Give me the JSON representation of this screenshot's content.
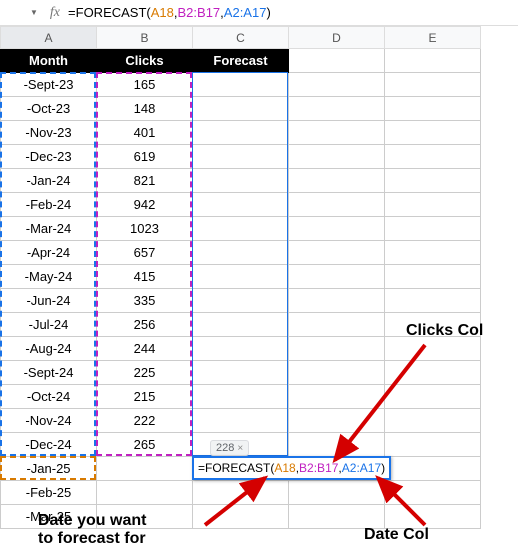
{
  "formula_bar": {
    "fx_label": "fx",
    "formula_prefix": "=FORECAST(",
    "ref1": "A18",
    "comma": ",",
    "ref2": "B2:B17",
    "ref3": "A2:A17",
    "formula_suffix": ")"
  },
  "columns": {
    "A": "A",
    "B": "B",
    "C": "C",
    "D": "D",
    "E": "E"
  },
  "headers": {
    "A": "Month",
    "B": "Clicks",
    "C": "Forecast"
  },
  "rows": [
    {
      "month": "-Sept-23",
      "clicks": "165"
    },
    {
      "month": "-Oct-23",
      "clicks": "148"
    },
    {
      "month": "-Nov-23",
      "clicks": "401"
    },
    {
      "month": "-Dec-23",
      "clicks": "619"
    },
    {
      "month": "-Jan-24",
      "clicks": "821"
    },
    {
      "month": "-Feb-24",
      "clicks": "942"
    },
    {
      "month": "-Mar-24",
      "clicks": "1023"
    },
    {
      "month": "-Apr-24",
      "clicks": "657"
    },
    {
      "month": "-May-24",
      "clicks": "415"
    },
    {
      "month": "-Jun-24",
      "clicks": "335"
    },
    {
      "month": "-Jul-24",
      "clicks": "256"
    },
    {
      "month": "-Aug-24",
      "clicks": "244"
    },
    {
      "month": "-Sept-24",
      "clicks": "225"
    },
    {
      "month": "-Oct-24",
      "clicks": "215"
    },
    {
      "month": "-Nov-24",
      "clicks": "222"
    },
    {
      "month": "-Dec-24",
      "clicks": "265"
    },
    {
      "month": "-Jan-25",
      "clicks": ""
    },
    {
      "month": "-Feb-25",
      "clicks": ""
    },
    {
      "month": "-Mar-25",
      "clicks": ""
    }
  ],
  "hint": {
    "value": "228",
    "close": "×"
  },
  "cell_edit": {
    "prefix": "=FORECAST(",
    "ref1": "A18",
    "comma": ",",
    "ref2": "B2:B17",
    "ref3": "A2:A17",
    "suffix": ")"
  },
  "annotations": {
    "clicks_col": "Clicks Col",
    "date_for": "Date you want\nto forecast for",
    "date_col": "Date Col"
  }
}
